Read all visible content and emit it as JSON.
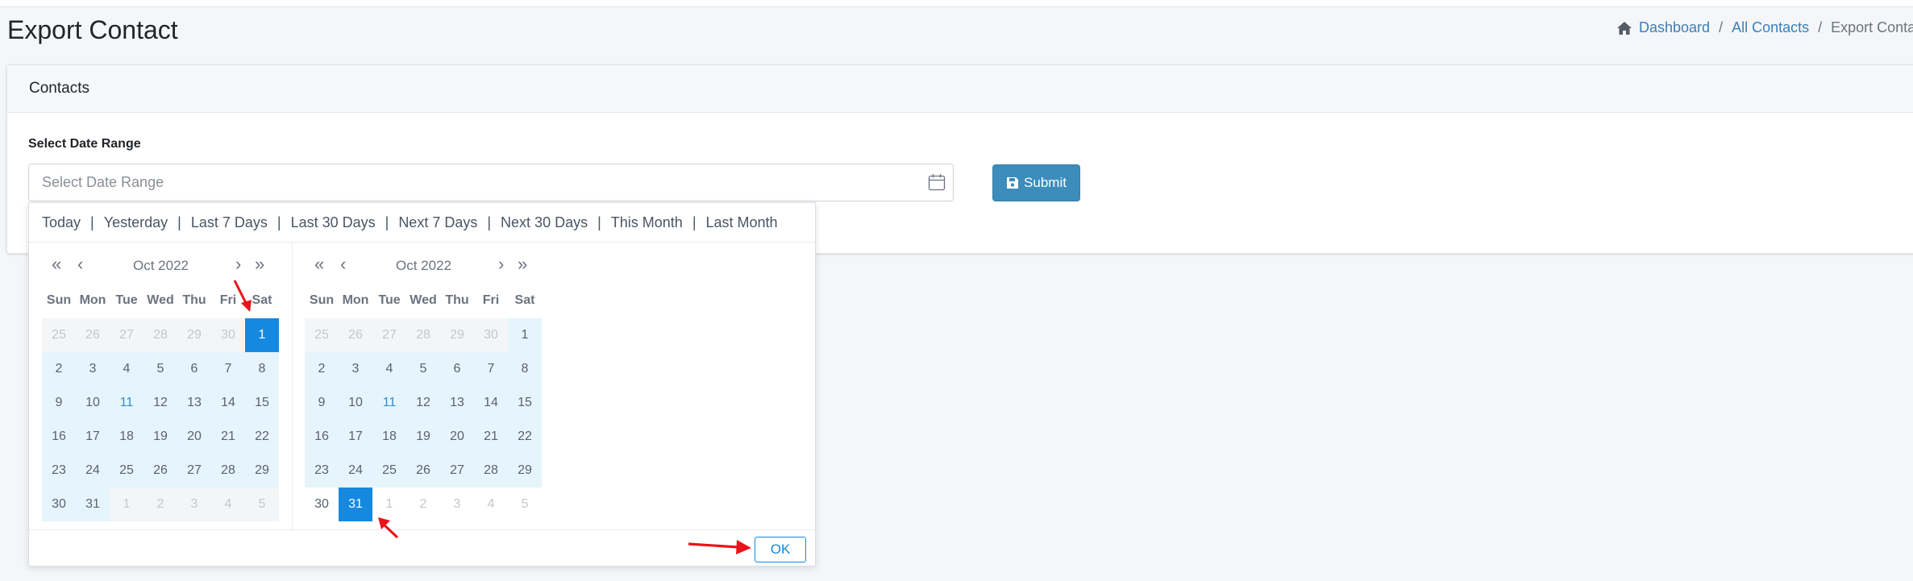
{
  "page": {
    "title": "Export Contact"
  },
  "breadcrumb": {
    "home": "Dashboard",
    "contacts": "All Contacts",
    "current": "Export Contact",
    "separator": "/"
  },
  "card": {
    "header": "Contacts"
  },
  "form": {
    "label": "Select Date Range",
    "placeholder": "Select Date Range",
    "submit_label": "Submit"
  },
  "picker": {
    "shortcuts": [
      "Today",
      "Yesterday",
      "Last 7 Days",
      "Last 30 Days",
      "Next 7 Days",
      "Next 30 Days",
      "This Month",
      "Last Month"
    ],
    "shortcut_separator": "|",
    "nav": {
      "prev_year": "«",
      "prev_month": "‹",
      "next_month": "›",
      "next_year": "»"
    },
    "weekdays": [
      "Sun",
      "Mon",
      "Tue",
      "Wed",
      "Thu",
      "Fri",
      "Sat"
    ],
    "left": {
      "month_label": "Oct 2022",
      "weeks": [
        [
          "25",
          "26",
          "27",
          "28",
          "29",
          "30",
          "1"
        ],
        [
          "2",
          "3",
          "4",
          "5",
          "6",
          "7",
          "8"
        ],
        [
          "9",
          "10",
          "11",
          "12",
          "13",
          "14",
          "15"
        ],
        [
          "16",
          "17",
          "18",
          "19",
          "20",
          "21",
          "22"
        ],
        [
          "23",
          "24",
          "25",
          "26",
          "27",
          "28",
          "29"
        ],
        [
          "30",
          "31",
          "1",
          "2",
          "3",
          "4",
          "5"
        ]
      ]
    },
    "right": {
      "month_label": "Oct 2022",
      "weeks": [
        [
          "25",
          "26",
          "27",
          "28",
          "29",
          "30",
          "1"
        ],
        [
          "2",
          "3",
          "4",
          "5",
          "6",
          "7",
          "8"
        ],
        [
          "9",
          "10",
          "11",
          "12",
          "13",
          "14",
          "15"
        ],
        [
          "16",
          "17",
          "18",
          "19",
          "20",
          "21",
          "22"
        ],
        [
          "23",
          "24",
          "25",
          "26",
          "27",
          "28",
          "29"
        ],
        [
          "30",
          "31",
          "1",
          "2",
          "3",
          "4",
          "5"
        ]
      ]
    },
    "range_start": "1",
    "range_end": "31",
    "today": "11",
    "ok_label": "OK"
  },
  "colors": {
    "accent": "#1589e0",
    "submit": "#3c8dbc",
    "range": "#e6f4fb",
    "annotation": "#e8141b"
  },
  "icons": {
    "breadcrumb": "home-icon",
    "input": "calendar-icon",
    "submit": "save-icon"
  }
}
